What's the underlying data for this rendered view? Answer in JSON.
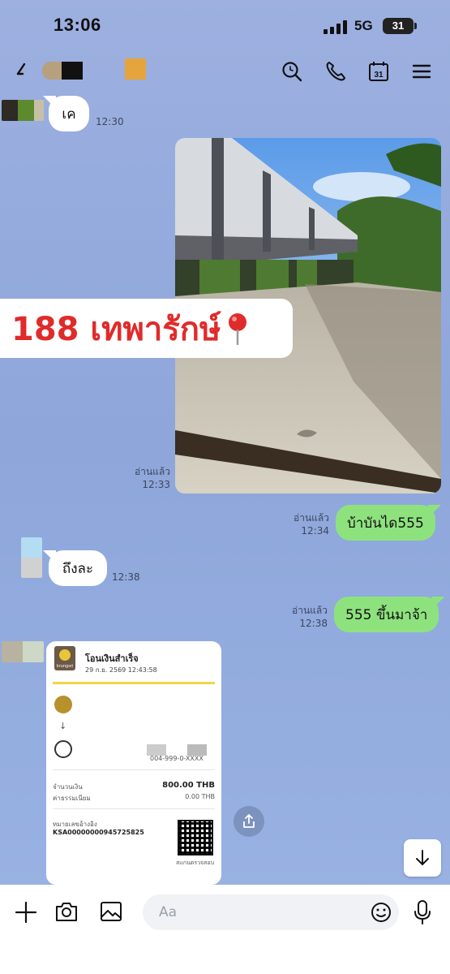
{
  "status_bar": {
    "time": "13:06",
    "network": "5G",
    "battery": "31"
  },
  "header": {
    "icons": [
      "back-icon",
      "search-icon",
      "phone-icon",
      "calendar-icon",
      "menu-icon"
    ],
    "calendar_day": "31"
  },
  "messages": [
    {
      "side": "in",
      "text": "เค",
      "time": "12:30"
    },
    {
      "side": "out",
      "type": "photo",
      "sticker_text": "188 เทพารักษ์",
      "read": "อ่านแล้ว",
      "time": "12:33"
    },
    {
      "side": "out",
      "text": "บ้าบันได555",
      "read": "อ่านแล้ว",
      "time": "12:34"
    },
    {
      "side": "in",
      "text": "ถึงละ",
      "time": "12:38"
    },
    {
      "side": "out",
      "text": "555 ขึ้นมาจ้า",
      "read": "อ่านแล้ว",
      "time": "12:38"
    }
  ],
  "slip": {
    "bank": "krungsri",
    "title": "โอนเงินสำเร็จ",
    "date": "29 ก.ย. 2569 12:43:58",
    "account_masked": "004-999-0-XXXX",
    "amount_label": "จำนวนเงิน",
    "amount": "800.00 THB",
    "fee_label": "ค่าธรรมเนียม",
    "fee": "0.00 THB",
    "ref_label": "หมายเลขอ้างอิง",
    "ref": "KSA00000000945725825",
    "qr_caption": "สแกนตรวจสอบ"
  },
  "input": {
    "placeholder": "Aa"
  },
  "colors": {
    "outgoing_bubble": "#8ee27e",
    "incoming_bubble": "#ffffff",
    "background": "#9db0e0",
    "sticker_text": "#e02b2b"
  }
}
